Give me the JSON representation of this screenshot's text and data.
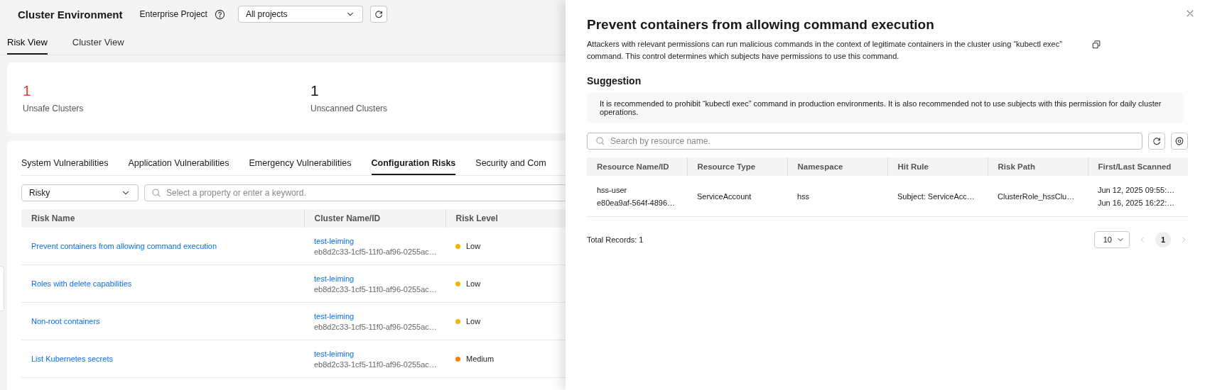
{
  "header": {
    "title": "Cluster Environment",
    "project_label": "Enterprise Project",
    "project_select": {
      "value": "All projects"
    }
  },
  "view_tabs": [
    {
      "label": "Risk View",
      "selected": true
    },
    {
      "label": "Cluster View",
      "selected": false
    }
  ],
  "summary": [
    {
      "value": "1",
      "label": "Unsafe Clusters",
      "kind": "danger"
    },
    {
      "value": "1",
      "label": "Unscanned Clusters",
      "kind": "normal"
    }
  ],
  "risk_tabs": [
    {
      "label": "System Vulnerabilities",
      "selected": false
    },
    {
      "label": "Application Vulnerabilities",
      "selected": false
    },
    {
      "label": "Emergency Vulnerabilities",
      "selected": false
    },
    {
      "label": "Configuration Risks",
      "selected": true
    },
    {
      "label": "Security and Com",
      "selected": false
    }
  ],
  "filter": {
    "status": "Risky",
    "search_placeholder": "Select a property or enter a keyword."
  },
  "risk_table": {
    "columns": [
      "Risk Name",
      "Cluster Name/ID",
      "Risk Level"
    ],
    "rows": [
      {
        "name": "Prevent containers from allowing command execution",
        "cluster": "test-leiming",
        "cluster_id": "eb8d2c33-1cf5-11f0-af96-0255ac…",
        "level": "Low",
        "color": "#f7b500"
      },
      {
        "name": "Roles with delete capabilities",
        "cluster": "test-leiming",
        "cluster_id": "eb8d2c33-1cf5-11f0-af96-0255ac…",
        "level": "Low",
        "color": "#f7b500"
      },
      {
        "name": "Non-root containers",
        "cluster": "test-leiming",
        "cluster_id": "eb8d2c33-1cf5-11f0-af96-0255ac…",
        "level": "Low",
        "color": "#f7b500"
      },
      {
        "name": "List Kubernetes secrets",
        "cluster": "test-leiming",
        "cluster_id": "eb8d2c33-1cf5-11f0-af96-0255ac…",
        "level": "Medium",
        "color": "#ff7d00"
      }
    ]
  },
  "drawer": {
    "title": "Prevent containers from allowing command execution",
    "description": "Attackers with relevant permissions can run malicious commands in the context of legitimate containers in the cluster using “kubectl exec” command. This control determines which subjects have permissions to use this command.",
    "suggestion_title": "Suggestion",
    "suggestion": "It is recommended to prohibit “kubectl exec” command in production environments. It is also recommended not to use subjects with this permission for daily cluster operations.",
    "search_placeholder": "Search by resource name.",
    "table": {
      "columns": [
        "Resource Name/ID",
        "Resource Type",
        "Namespace",
        "Hit Rule",
        "Risk Path",
        "First/Last Scanned"
      ],
      "rows": [
        {
          "resource_name": "hss-user",
          "resource_id": "e80ea9af-564f-4896…",
          "resource_type": "ServiceAccount",
          "namespace": "hss",
          "hit_rule": "Subject: ServiceAcc…",
          "risk_path": "ClusterRole_hssClu…",
          "first_scanned": "Jun 12, 2025 09:55:…",
          "last_scanned": "Jun 16, 2025 16:22:…"
        }
      ]
    },
    "total": "Total Records: 1",
    "page_size": "10",
    "pages": [
      {
        "label": "1",
        "selected": true
      }
    ]
  }
}
